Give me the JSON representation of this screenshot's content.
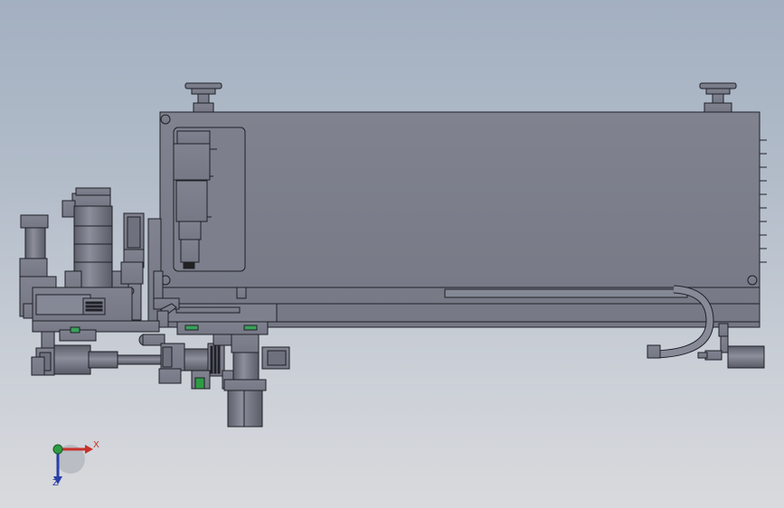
{
  "viewport": {
    "background_top": "#a3b0c1",
    "background_bottom": "#d9dadd",
    "model_color": "#7b7e8c",
    "edge_color": "#1f2028"
  },
  "triad": {
    "x_label": "X",
    "y_label": "Z",
    "x_color": "#c8322a",
    "y_color": "#2a3fa8",
    "origin_color": "#2f9c45"
  },
  "icons": [
    "coordinate-triad-icon"
  ]
}
